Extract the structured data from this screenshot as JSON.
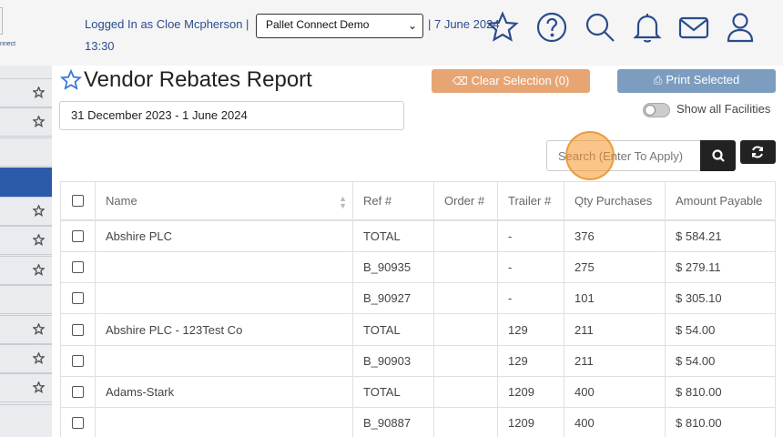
{
  "header": {
    "logo_text": "nnect",
    "login_text": "Logged In as Cloe Mcpherson |",
    "organization": "Pallet Connect Demo",
    "date_text": "| 7 June 2024",
    "time_text": "13:30"
  },
  "page": {
    "title": "Vendor Rebates Report",
    "date_range": "31 December 2023 - 1 June 2024",
    "clear_selection_label": "Clear Selection (0)",
    "print_selected_label": "Print Selected",
    "show_all_facilities_label": "Show all Facilities",
    "search_placeholder": "Search (Enter To Apply)"
  },
  "table": {
    "columns": [
      "Name",
      "Ref #",
      "Order #",
      "Trailer #",
      "Qty Purchases",
      "Amount Payable"
    ],
    "rows": [
      {
        "name": "Abshire PLC",
        "ref": "TOTAL",
        "order": "",
        "trailer": "-",
        "qty": "376",
        "amount": "$ 584.21"
      },
      {
        "name": "",
        "ref": "B_90935",
        "order": "",
        "trailer": "-",
        "qty": "275",
        "amount": "$ 279.11"
      },
      {
        "name": "",
        "ref": "B_90927",
        "order": "",
        "trailer": "-",
        "qty": "101",
        "amount": "$ 305.10"
      },
      {
        "name": "Abshire PLC - 123Test Co",
        "ref": "TOTAL",
        "order": "",
        "trailer": "129",
        "qty": "211",
        "amount": "$ 54.00"
      },
      {
        "name": "",
        "ref": "B_90903",
        "order": "",
        "trailer": "129",
        "qty": "211",
        "amount": "$ 54.00"
      },
      {
        "name": "Adams-Stark",
        "ref": "TOTAL",
        "order": "",
        "trailer": "1209",
        "qty": "400",
        "amount": "$ 810.00"
      },
      {
        "name": "",
        "ref": "B_90887",
        "order": "",
        "trailer": "1209",
        "qty": "400",
        "amount": "$ 810.00"
      }
    ]
  },
  "colors": {
    "brand": "#2b4c8c",
    "clear_button": "#e8a574",
    "print_button": "#7c9cc0",
    "sidebar_active": "#2b5aa8"
  }
}
